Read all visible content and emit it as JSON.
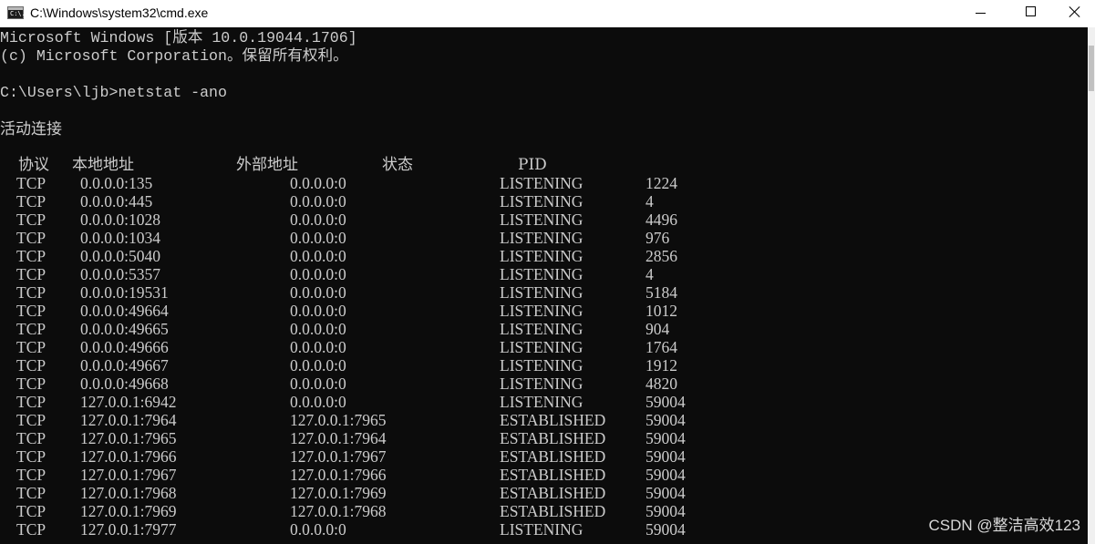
{
  "window": {
    "title": "C:\\Windows\\system32\\cmd.exe",
    "icon": "cmd-icon",
    "icon_text": "C:\\."
  },
  "console": {
    "banner_line1": "Microsoft Windows [版本 10.0.19044.1706]",
    "banner_line2": "(c) Microsoft Corporation。保留所有权利。",
    "prompt_line": "C:\\Users\\ljb>netstat -ano",
    "section_title": "活动连接",
    "headers": {
      "proto": "协议",
      "local": "本地地址",
      "foreign": "外部地址",
      "state": "状态",
      "pid": "PID"
    },
    "rows": [
      {
        "proto": "TCP",
        "local": "0.0.0.0:135",
        "foreign": "0.0.0.0:0",
        "state": "LISTENING",
        "pid": "1224"
      },
      {
        "proto": "TCP",
        "local": "0.0.0.0:445",
        "foreign": "0.0.0.0:0",
        "state": "LISTENING",
        "pid": "4"
      },
      {
        "proto": "TCP",
        "local": "0.0.0.0:1028",
        "foreign": "0.0.0.0:0",
        "state": "LISTENING",
        "pid": "4496"
      },
      {
        "proto": "TCP",
        "local": "0.0.0.0:1034",
        "foreign": "0.0.0.0:0",
        "state": "LISTENING",
        "pid": "976"
      },
      {
        "proto": "TCP",
        "local": "0.0.0.0:5040",
        "foreign": "0.0.0.0:0",
        "state": "LISTENING",
        "pid": "2856"
      },
      {
        "proto": "TCP",
        "local": "0.0.0.0:5357",
        "foreign": "0.0.0.0:0",
        "state": "LISTENING",
        "pid": "4"
      },
      {
        "proto": "TCP",
        "local": "0.0.0.0:19531",
        "foreign": "0.0.0.0:0",
        "state": "LISTENING",
        "pid": "5184"
      },
      {
        "proto": "TCP",
        "local": "0.0.0.0:49664",
        "foreign": "0.0.0.0:0",
        "state": "LISTENING",
        "pid": "1012"
      },
      {
        "proto": "TCP",
        "local": "0.0.0.0:49665",
        "foreign": "0.0.0.0:0",
        "state": "LISTENING",
        "pid": "904"
      },
      {
        "proto": "TCP",
        "local": "0.0.0.0:49666",
        "foreign": "0.0.0.0:0",
        "state": "LISTENING",
        "pid": "1764"
      },
      {
        "proto": "TCP",
        "local": "0.0.0.0:49667",
        "foreign": "0.0.0.0:0",
        "state": "LISTENING",
        "pid": "1912"
      },
      {
        "proto": "TCP",
        "local": "0.0.0.0:49668",
        "foreign": "0.0.0.0:0",
        "state": "LISTENING",
        "pid": "4820"
      },
      {
        "proto": "TCP",
        "local": "127.0.0.1:6942",
        "foreign": "0.0.0.0:0",
        "state": "LISTENING",
        "pid": "59004"
      },
      {
        "proto": "TCP",
        "local": "127.0.0.1:7964",
        "foreign": "127.0.0.1:7965",
        "state": "ESTABLISHED",
        "pid": "59004"
      },
      {
        "proto": "TCP",
        "local": "127.0.0.1:7965",
        "foreign": "127.0.0.1:7964",
        "state": "ESTABLISHED",
        "pid": "59004"
      },
      {
        "proto": "TCP",
        "local": "127.0.0.1:7966",
        "foreign": "127.0.0.1:7967",
        "state": "ESTABLISHED",
        "pid": "59004"
      },
      {
        "proto": "TCP",
        "local": "127.0.0.1:7967",
        "foreign": "127.0.0.1:7966",
        "state": "ESTABLISHED",
        "pid": "59004"
      },
      {
        "proto": "TCP",
        "local": "127.0.0.1:7968",
        "foreign": "127.0.0.1:7969",
        "state": "ESTABLISHED",
        "pid": "59004"
      },
      {
        "proto": "TCP",
        "local": "127.0.0.1:7969",
        "foreign": "127.0.0.1:7968",
        "state": "ESTABLISHED",
        "pid": "59004"
      },
      {
        "proto": "TCP",
        "local": "127.0.0.1:7977",
        "foreign": "0.0.0.0:0",
        "state": "LISTENING",
        "pid": "59004"
      }
    ]
  },
  "watermark": "CSDN @整洁高效123",
  "colors": {
    "console_background": "#0c0c0c",
    "console_text": "#cccccc",
    "titlebar_background": "#ffffff"
  }
}
